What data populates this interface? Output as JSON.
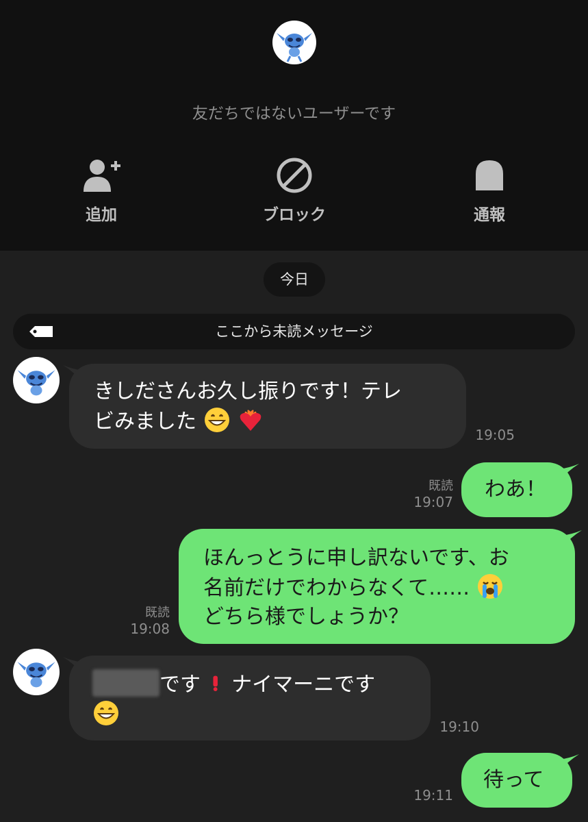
{
  "header": {
    "notice": "友だちではないユーザーです",
    "actions": {
      "add": {
        "label": "追加",
        "icon": "add-friend-icon"
      },
      "block": {
        "label": "ブロック",
        "icon": "block-icon"
      },
      "report": {
        "label": "通報",
        "icon": "report-icon"
      }
    }
  },
  "chat": {
    "date_label": "今日",
    "unread_label": "ここから未読メッセージ",
    "messages": [
      {
        "side": "incoming",
        "text_line1": "きしださんお久し振りです！テレ",
        "text_line2": "ビみました",
        "emojis": [
          "grinning-face",
          "heart-on-fire"
        ],
        "time": "19:05"
      },
      {
        "side": "outgoing",
        "text": "わあ！",
        "read": "既読",
        "time": "19:07"
      },
      {
        "side": "outgoing",
        "text_line1": "ほんっとうに申し訳ないです、お",
        "text_line2": "名前だけでわからなくて……",
        "text_line3": "どちら様でしょうか？",
        "emojis": [
          "crying-face"
        ],
        "read": "既読",
        "time": "19:08"
      },
      {
        "side": "incoming",
        "text_line1": "です",
        "text_line1b": " ナイマーニです",
        "emojis": [
          "exclamation-mark",
          "grinning-face"
        ],
        "redacted": true,
        "time": "19:10"
      },
      {
        "side": "outgoing",
        "text": "待って",
        "time": "19:11"
      }
    ]
  },
  "colors": {
    "background": "#1f1f1f",
    "header_background": "#111111",
    "incoming_bubble": "#2d2d2d",
    "outgoing_bubble": "#6ee476",
    "secondary_text": "#8e8e8e"
  }
}
